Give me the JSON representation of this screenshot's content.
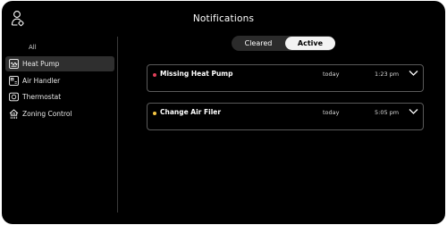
{
  "header": {
    "title": "Notifications",
    "user_icon": "user-settings-icon"
  },
  "sidebar": {
    "items": [
      {
        "label": "All",
        "icon": ""
      },
      {
        "label": "Heat Pump",
        "icon": "heat-pump-icon",
        "selected": true
      },
      {
        "label": "Air Handler",
        "icon": "air-handler-icon"
      },
      {
        "label": "Thermostat",
        "icon": "thermostat-icon"
      },
      {
        "label": "Zoning Control",
        "icon": "zoning-control-icon"
      }
    ]
  },
  "filter": {
    "options": [
      "Cleared",
      "Active"
    ],
    "selected": "Active"
  },
  "notifications": [
    {
      "title": "Missing Heat Pump",
      "day": "today",
      "time": "1:23 pm",
      "severity_color": "#e0405a"
    },
    {
      "title": "Change Air Filer",
      "day": "today",
      "time": "5:05 pm",
      "severity_color": "#f5c542"
    }
  ],
  "colors": {
    "background": "#000000",
    "accent_active": "#f3f3f3",
    "selected_row": "#2f2f2f"
  }
}
